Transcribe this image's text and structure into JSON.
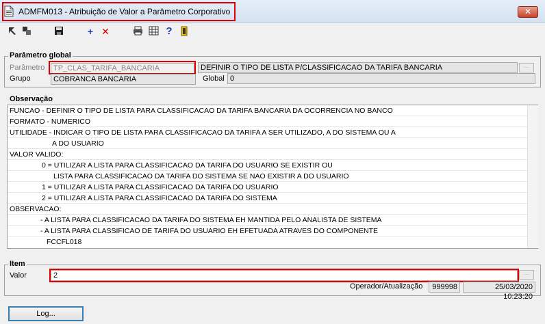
{
  "window": {
    "title": "ADMFM013 - Atribuição de Valor a Parâmetro Corporativo",
    "close_label": "✕"
  },
  "toolbar": {
    "buttons": [
      {
        "icon": "arrow-back-icon",
        "glyph": "◥"
      },
      {
        "icon": "copy-icon",
        "glyph": "▚"
      },
      {
        "icon": "save-icon",
        "glyph": "💾"
      },
      {
        "icon": "add-icon",
        "glyph": "+"
      },
      {
        "icon": "delete-icon",
        "glyph": "✕"
      },
      {
        "icon": "print-icon",
        "glyph": "⎙"
      },
      {
        "icon": "grid-icon",
        "glyph": "▦"
      },
      {
        "icon": "help-icon",
        "glyph": "?"
      },
      {
        "icon": "exit-icon",
        "glyph": "⇥"
      }
    ]
  },
  "parametro_global": {
    "title": "Parâmetro global",
    "parametro_label": "Parâmetro",
    "parametro_value": "TP_CLAS_TARIFA_BANCARIA",
    "parametro_description": "DEFINIR O TIPO DE LISTA P/CLASSIFICACAO DA TARIFA BANCARIA",
    "grupo_label": "Grupo",
    "grupo_value": "COBRANCA BANCARIA",
    "global_label": "Global",
    "global_value": "0"
  },
  "observacao": {
    "title": "Observação",
    "lines": [
      "FUNCAO - DEFINIR O TIPO DE LISTA PARA CLASSIFICACAO DA TARIFA BANCARIA DA OCORRENCIA NO BANCO",
      "FORMATO - NUMERICO",
      "UTILIDADE - INDICAR O TIPO DE LISTA PARA CLASSIFICACAO DA TARIFA A SER UTILIZADO, A DO SISTEMA OU A",
      "A DO USUARIO",
      "VALOR VALIDO:",
      "0 = UTILIZAR A LISTA PARA CLASSIFICACAO DA TARIFA DO USUARIO SE EXISTIR OU",
      "LISTA PARA CLASSIFICACAO DA TARIFA DO SISTEMA SE NAO EXISTIR A DO USUARIO",
      "1 = UTILIZAR A LISTA PARA CLASSIFICACAO DA TARIFA DO USUARIO",
      "2 = UTILIZAR A LISTA PARA CLASSIFICACAO DA TARIFA DO SISTEMA",
      "OBSERVACAO:",
      "- A LISTA PARA CLASSIFICACAO DA TARIFA DO SISTEMA EH MANTIDA PELO ANALISTA DE SISTEMA",
      "- A LISTA PARA CLASSIFICAO DE TARIFA DO USUARIO EH EFETUADA ATRAVES DO COMPONENTE",
      "FCCFL018"
    ]
  },
  "item": {
    "title": "Item",
    "valor_label": "Valor",
    "valor_value": "2",
    "operador_label": "Operador/Atualização",
    "operador_value": "999998",
    "atualizacao_value": "25/03/2020 10:23:20"
  },
  "log_button": "Log..."
}
